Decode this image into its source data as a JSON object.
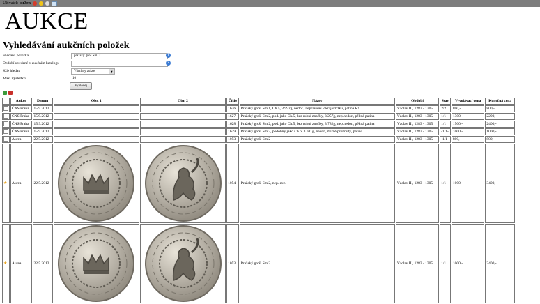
{
  "topbar": {
    "label": "Uživatel:",
    "user": "dr3en"
  },
  "logo": "AUKCE",
  "title": "Vyhledávání aukčních položek",
  "form": {
    "search_label": "Hledaná položka",
    "search_value": "pražský groš Sm. 2",
    "period_label": "Období uvedené v aukčním katalogu",
    "period_value": "",
    "where_label": "Kde hledat",
    "where_value": "Všechny aukce",
    "max_label": "Max. výsledků",
    "max_value": "10",
    "submit": "Vyhledej",
    "help": "?"
  },
  "table": {
    "headers": [
      "",
      "Aukce",
      "Datum",
      "Obr. 1",
      "Obr. 2",
      "Číslo",
      "Název",
      "Období",
      "Stav",
      "Vyvolávací cena",
      "Konečná cena"
    ],
    "rows": [
      {
        "aukce": "ČNS Praha",
        "datum": "15.9.2012",
        "cislo": "1626",
        "nazev": "Pražský groš, Sm.1, Ch.5, 3.992g, nedor., nepravidel. okraj střížku, patina R!",
        "obdobi": "Václav II., 1283 - 1305",
        "stav": "2/2",
        "vyvolavaci": "800,-",
        "konecna": "800,-"
      },
      {
        "aukce": "ČNS Praha",
        "datum": "15.9.2012",
        "cislo": "1627",
        "nazev": "Pražský groš, Sm.2, pod. jako Ch.5, bez rubní značky, 3.257g, nep.nedor., pěkná patina",
        "obdobi": "Václav II., 1283 - 1305",
        "stav": "1/1",
        "vyvolavaci": "1300,-",
        "konecna": "2200,-"
      },
      {
        "aukce": "ČNS Praha",
        "datum": "15.9.2012",
        "cislo": "1628",
        "nazev": "Pražský groš, Sm.2, pod. jako Ch.5, bez rubní značky, 3.782g, nep.nedor., pěkná patina",
        "obdobi": "Václav II., 1283 - 1305",
        "stav": "1/1",
        "vyvolavaci": "1500,-",
        "konecna": "2400,-"
      },
      {
        "aukce": "ČNS Praha",
        "datum": "15.9.2012",
        "cislo": "1629",
        "nazev": "Pražský groš, Sm.2, podobný jako Ch.6, 3.681g, nedor., mírně prohnutý, patina",
        "obdobi": "Václav II., 1283 - 1305",
        "stav": "-1/1-",
        "vyvolavaci": "1000,-",
        "konecna": "1000,-"
      },
      {
        "aukce": "Aurea",
        "datum": "22.5.2012",
        "cislo": "1053",
        "nazev": "Pražský groš, Sm.2",
        "obdobi": "Václav II., 1283 - 1305",
        "stav": "-1/1-",
        "vyvolavaci": "800,-",
        "konecna": "800,-"
      }
    ],
    "coin_rows": [
      {
        "aukce": "Aurea",
        "datum": "22.5.2012",
        "cislo": "1054",
        "nazev": "Pražský groš, Sm.2, nep. exc.",
        "obdobi": "Václav II., 1283 - 1305",
        "stav": "1/1",
        "vyvolavaci": "1000,-",
        "konecna": "3400,-"
      },
      {
        "aukce": "Aurea",
        "datum": "22.5.2012",
        "cislo": "1053",
        "nazev": "Pražský groš, Sm.2",
        "obdobi": "Václav II., 1283 - 1305",
        "stav": "1/1",
        "vyvolavaci": "1000,-",
        "konecna": "3400,-"
      }
    ]
  },
  "colors": {
    "topbar": "#7d7d7d",
    "help": "#3b7bd3",
    "star": "#e8a21a"
  }
}
